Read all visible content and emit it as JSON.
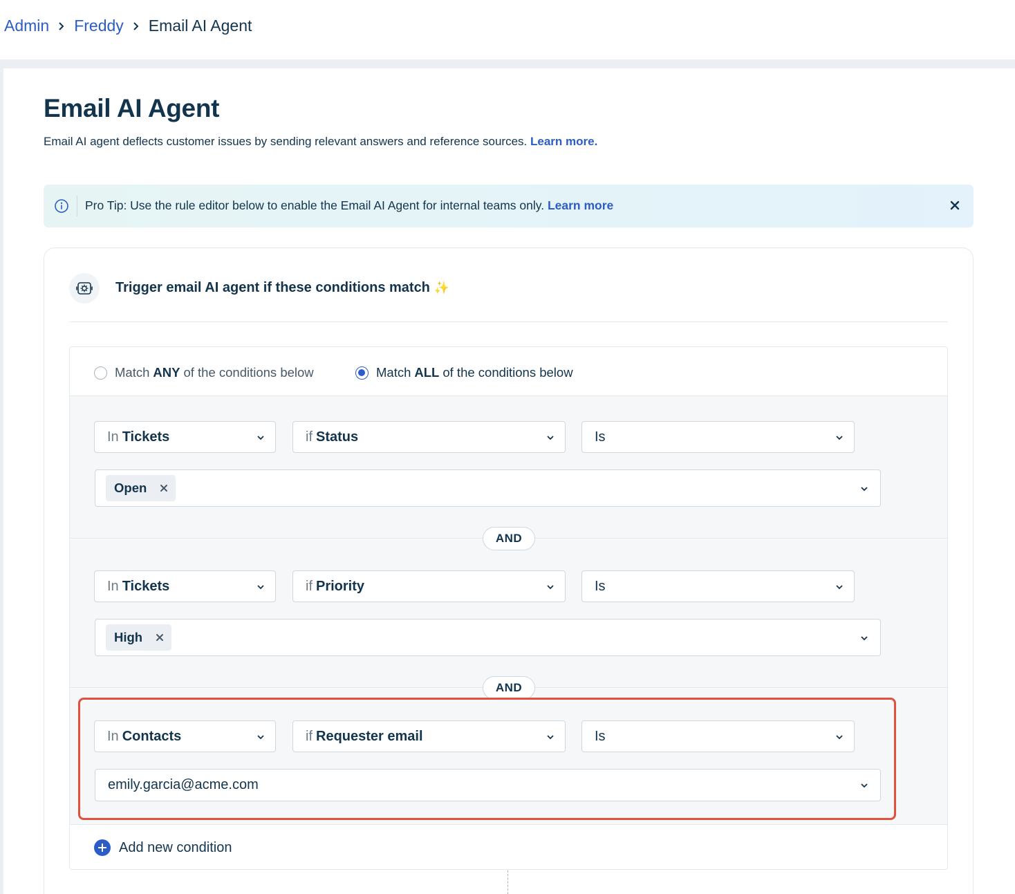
{
  "breadcrumb": {
    "items": [
      {
        "label": "Admin"
      },
      {
        "label": "Freddy"
      },
      {
        "label": "Email AI Agent"
      }
    ]
  },
  "page": {
    "title": "Email AI Agent",
    "description": "Email AI agent deflects customer issues by sending relevant answers and reference sources.",
    "learn_more": "Learn more."
  },
  "tip": {
    "text": "Pro Tip: Use the rule editor below to enable the Email AI Agent for internal teams only.",
    "link": "Learn more"
  },
  "card": {
    "title": "Trigger email AI agent if these conditions match",
    "sparkle": "✨"
  },
  "match": {
    "any": {
      "prefix": "Match",
      "bold": "ANY",
      "suffix": "of the conditions below",
      "selected": false
    },
    "all": {
      "prefix": "Match",
      "bold": "ALL",
      "suffix": "of the conditions below",
      "selected": true
    }
  },
  "conditions": [
    {
      "scope": {
        "prefix": "In",
        "value": "Tickets"
      },
      "field": {
        "prefix": "if",
        "value": "Status"
      },
      "operator": "Is",
      "values": [
        "Open"
      ]
    },
    {
      "scope": {
        "prefix": "In",
        "value": "Tickets"
      },
      "field": {
        "prefix": "if",
        "value": "Priority"
      },
      "operator": "Is",
      "values": [
        "High"
      ]
    },
    {
      "scope": {
        "prefix": "In",
        "value": "Contacts"
      },
      "field": {
        "prefix": "if",
        "value": "Requester email"
      },
      "operator": "Is",
      "text_value": "emily.garcia@acme.com"
    }
  ],
  "connector": "AND",
  "add_condition": "Add new condition",
  "colors": {
    "accent": "#2c5cc5",
    "text": "#12344d",
    "highlight": "#e0503c"
  }
}
